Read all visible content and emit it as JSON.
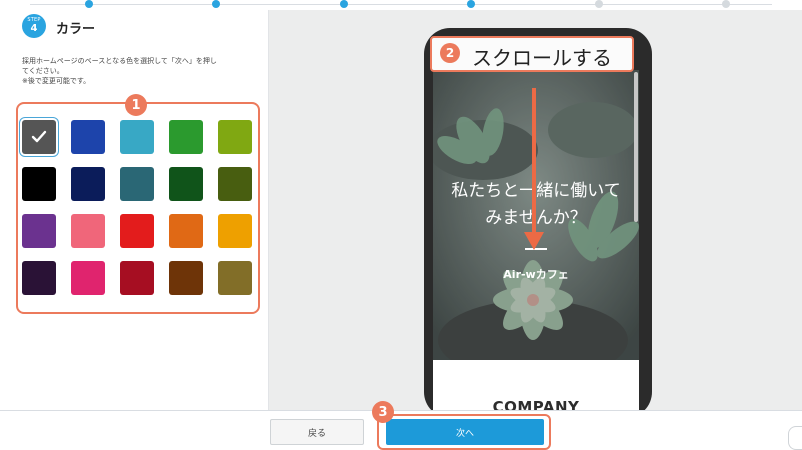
{
  "stepper": {
    "dot_color": "#2aa4e0",
    "line_color": "#d9dde2"
  },
  "section": {
    "step_badge_top": "STEP",
    "step_number": "4",
    "title": "カラー",
    "instruction_lines": [
      "採用ホームページのベースとなる色を選択して「次へ」を押し",
      "てください。",
      "※後で変更可能です。"
    ],
    "badge_color": "#2aa4e0"
  },
  "palette": {
    "selected_index": 0,
    "selected_icon": "checkmark-icon",
    "colors": [
      "#555555",
      "#1d44ab",
      "#38a8c5",
      "#2b9a2e",
      "#80a812",
      "#000000",
      "#0b1c5a",
      "#2a6775",
      "#10541a",
      "#485e10",
      "#6b328f",
      "#f0667a",
      "#e31c1c",
      "#e06915",
      "#eea000",
      "#2a1236",
      "#e0246e",
      "#a60e22",
      "#6e3408",
      "#826e28"
    ]
  },
  "annotations": {
    "callout_1": "1",
    "callout_2": "2",
    "callout_3": "3",
    "scroll_label": "スクロールする",
    "accent_color": "#ec7a5c",
    "arrow_color": "#ec6a45"
  },
  "preview": {
    "hero_line_1": "私たちと一緒に働いて",
    "hero_line_2": "みませんか？",
    "brand": "Air-wカフェ",
    "company_heading": "COMPANY"
  },
  "footer": {
    "back_label": "戻る",
    "next_label": "次へ",
    "next_color": "#1d9ad9"
  }
}
